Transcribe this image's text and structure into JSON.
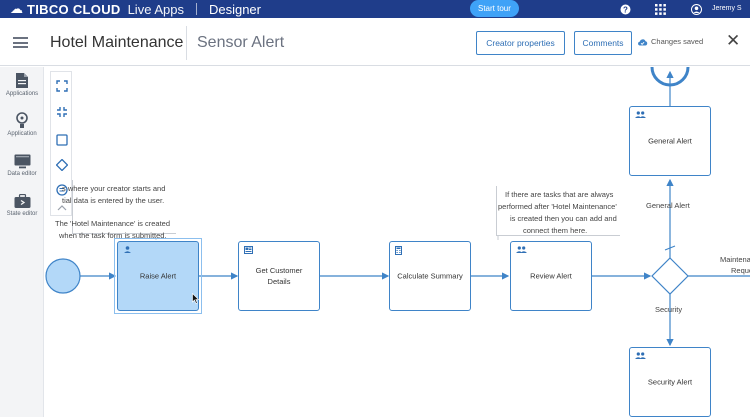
{
  "topbar": {
    "brand": "TIBCO CLOUD",
    "product": "Live Apps",
    "section": "Designer",
    "start_tour": "Start tour",
    "help_icon": "help-icon",
    "apps_icon": "grid-icon",
    "user_name": "Jeremy S"
  },
  "header": {
    "app_title": "Hotel Maintenance",
    "process_title": "Sensor Alert",
    "creator_properties": "Creator properties",
    "comments": "Comments",
    "changes_saved": "Changes saved"
  },
  "leftnav": {
    "items": [
      {
        "label": "Applications",
        "icon": "document-icon"
      },
      {
        "label": "Application",
        "icon": "lightbulb-icon"
      },
      {
        "label": "Data editor",
        "icon": "monitor-icon"
      },
      {
        "label": "State editor",
        "icon": "briefcase-icon"
      }
    ]
  },
  "canvas": {
    "notes": {
      "start_note_1": "s where your creator starts and",
      "start_note_2": "tial data is entered by the user.",
      "start_note_3": "The 'Hotel Maintenance' is created",
      "start_note_4": "when the task form is submitted.",
      "review_note_1": "If there are tasks that are always",
      "review_note_2": "performed after 'Hotel Maintenance'",
      "review_note_3": "is created then you can add and",
      "review_note_4": "connect them here."
    },
    "nodes": {
      "raise_alert": "Raise Alert",
      "get_customer_details_1": "Get Customer",
      "get_customer_details_2": "Details",
      "calculate_summary": "Calculate Summary",
      "review_alert": "Review Alert",
      "general_alert": "General Alert",
      "security_alert": "Security Alert"
    },
    "edge_labels": {
      "general_alert": "General Alert",
      "security": "Security",
      "maintenance_1": "Maintena",
      "maintenance_2": "Reque"
    }
  },
  "colors": {
    "topbar": "#1f3d8a",
    "accent": "#3f84c8",
    "selected_fill": "#b3d8f8",
    "start_tour": "#3fa2f7"
  }
}
